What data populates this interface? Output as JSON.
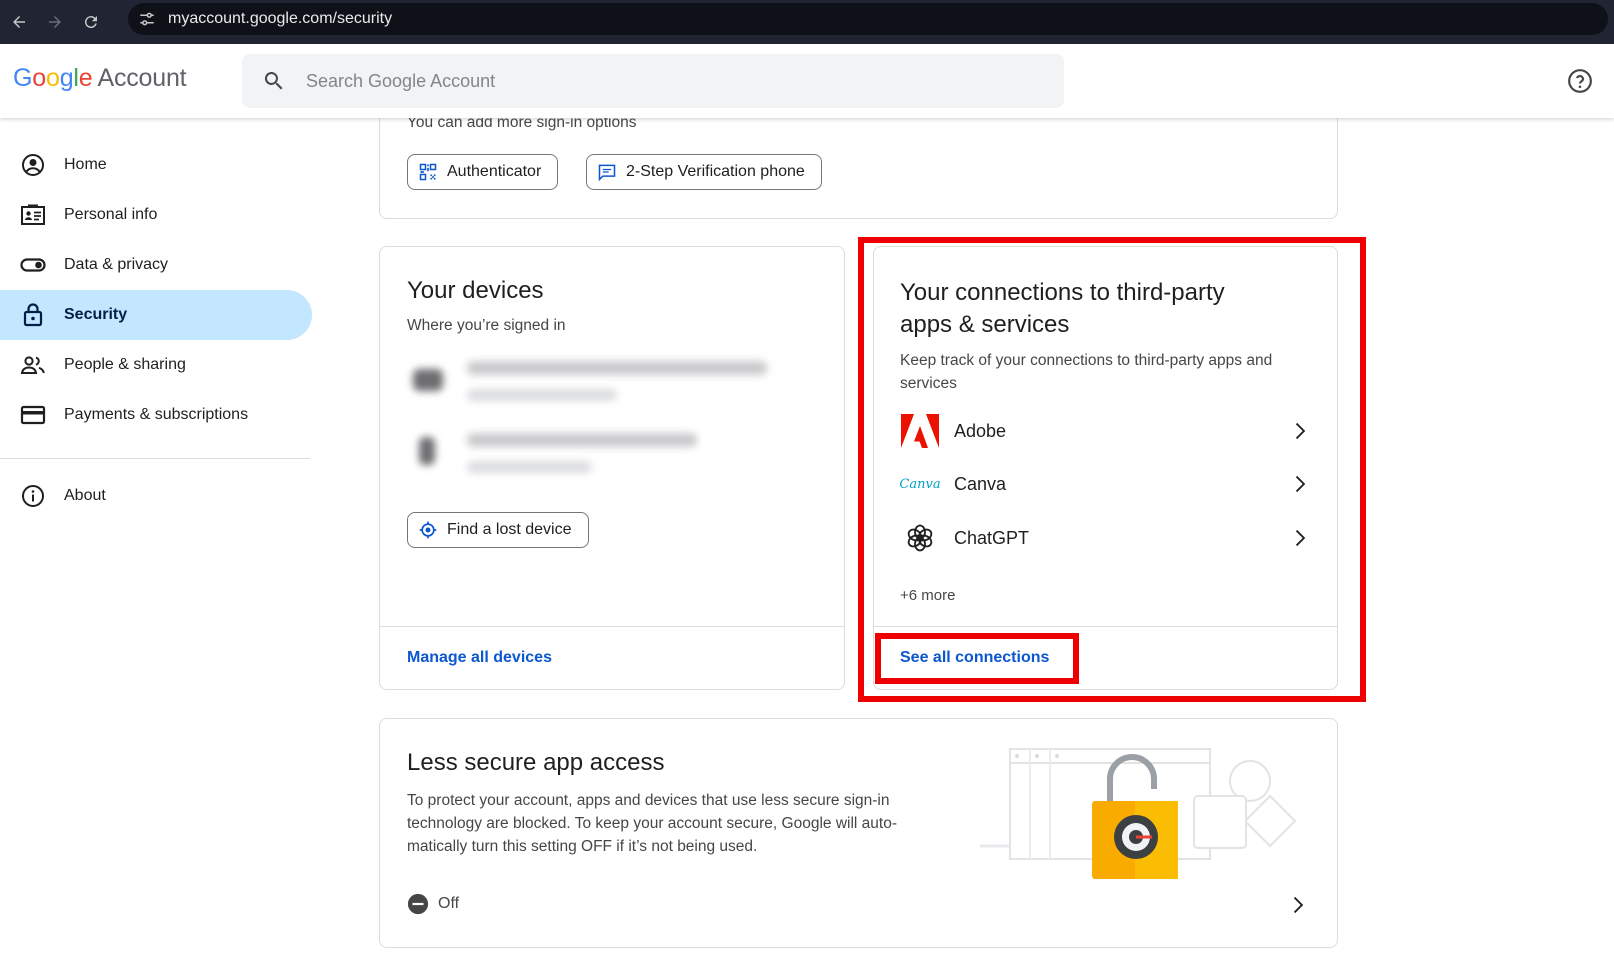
{
  "browser": {
    "url": "myaccount.google.com/security"
  },
  "header": {
    "logo_google": [
      "G",
      "o",
      "o",
      "g",
      "l",
      "e"
    ],
    "logo_account": "Account",
    "search_placeholder": "Search Google Account"
  },
  "sidebar": {
    "items": [
      {
        "label": "Home",
        "icon": "account-circle-icon"
      },
      {
        "label": "Personal info",
        "icon": "id-card-icon"
      },
      {
        "label": "Data & privacy",
        "icon": "toggle-icon"
      },
      {
        "label": "Security",
        "icon": "lock-icon",
        "active": true
      },
      {
        "label": "People & sharing",
        "icon": "people-icon"
      },
      {
        "label": "Payments & subscriptions",
        "icon": "credit-card-icon"
      }
    ],
    "about": {
      "label": "About",
      "icon": "info-icon"
    }
  },
  "signin_card": {
    "note": "You can add more sign-in options",
    "authenticator_label": "Authenticator",
    "two_step_label": "2-Step Verification phone"
  },
  "devices_card": {
    "title": "Your devices",
    "subtitle": "Where you’re signed in",
    "find_device_label": "Find a lost device",
    "manage_link": "Manage all devices"
  },
  "connections_card": {
    "title_line1": "Your connections to third-party",
    "title_line2": "apps & services",
    "desc_line1": "Keep track of your connections to third-party apps and",
    "desc_line2": "services",
    "apps": [
      {
        "name": "Adobe",
        "icon": "adobe-icon"
      },
      {
        "name": "Canva",
        "icon": "canva-icon",
        "logo_text": "Canva"
      },
      {
        "name": "ChatGPT",
        "icon": "chatgpt-icon"
      }
    ],
    "more": "+6 more",
    "see_all_link": "See all connections",
    "highlight_color": "#ee0000"
  },
  "less_secure_card": {
    "title": "Less secure app access",
    "desc_line1": "To protect your account, apps and devices that use less secure sign-in",
    "desc_line2": "technology are blocked. To keep your account secure, Google will auto-",
    "desc_line3": "matically turn this setting OFF if it’s not being used.",
    "status": "Off"
  },
  "colors": {
    "active_nav_bg": "#c2e7ff",
    "link": "#0b57d0"
  }
}
